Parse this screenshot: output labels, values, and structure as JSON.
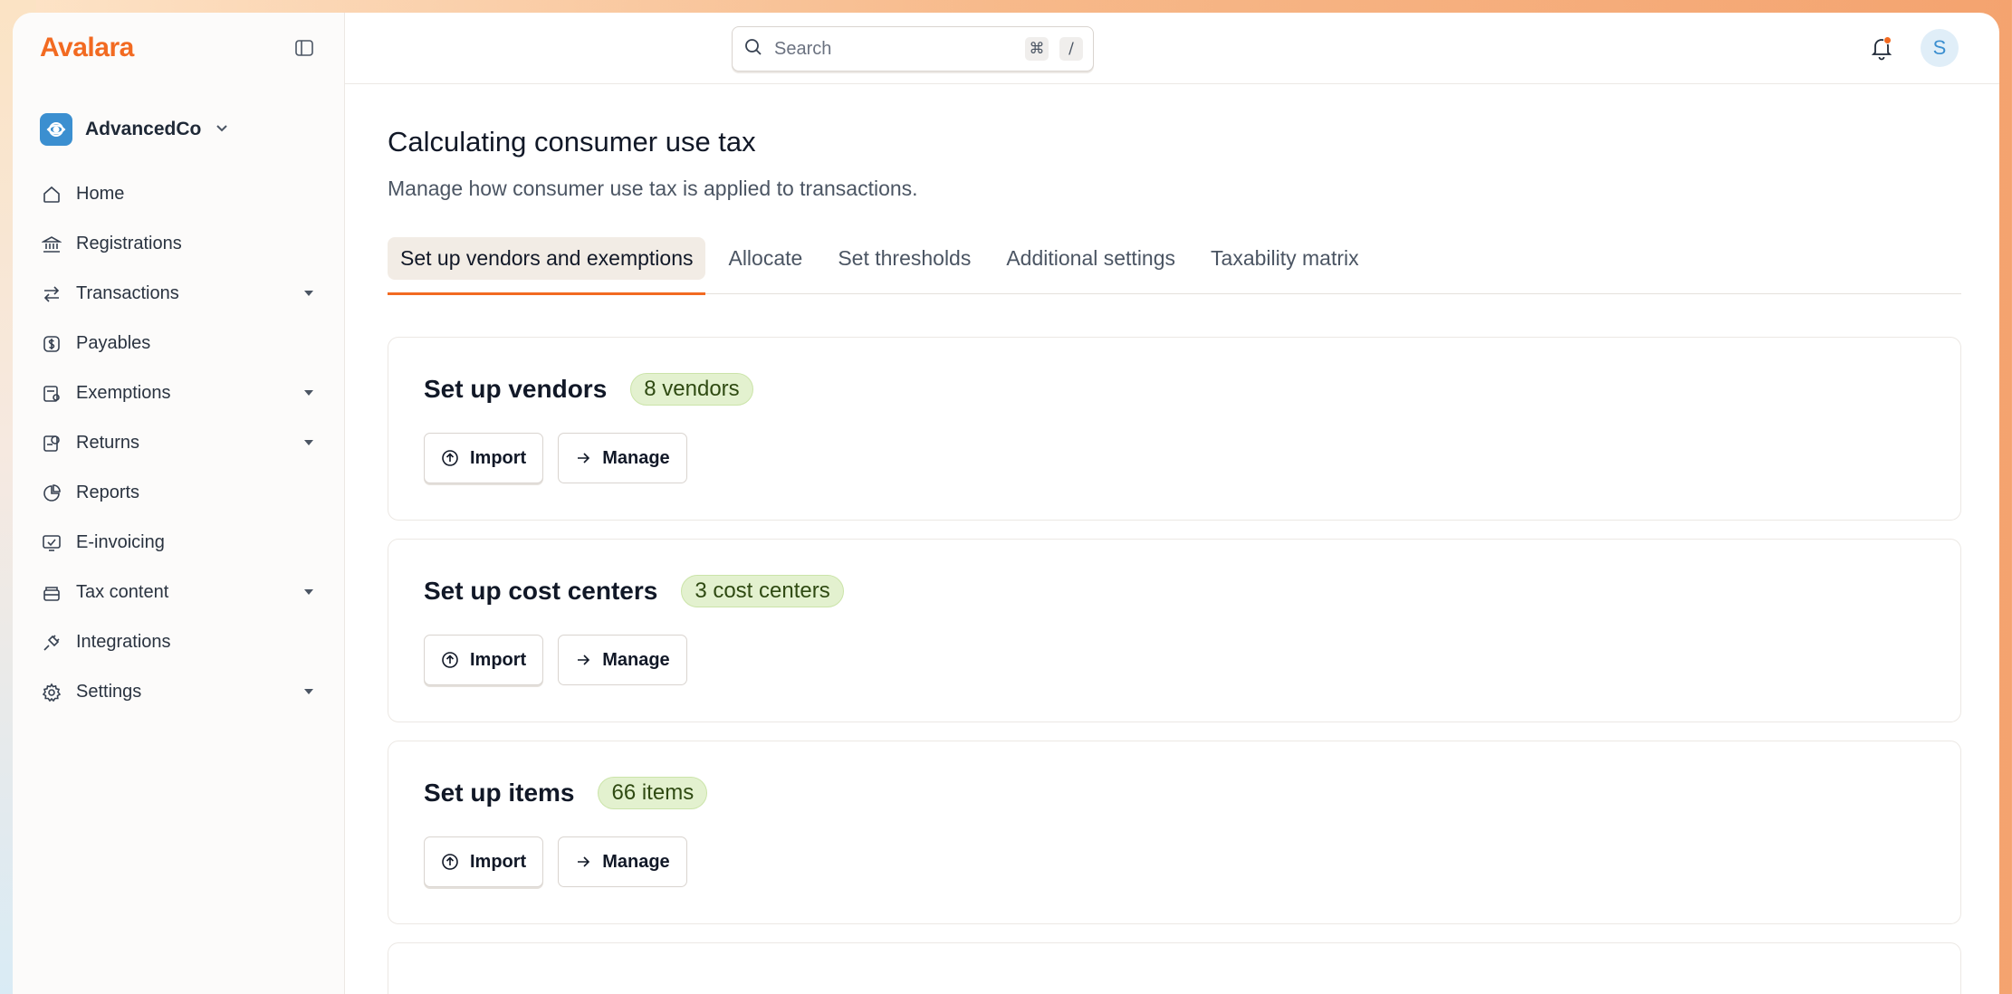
{
  "app": {
    "logo_text": "Avalara",
    "colors": {
      "brand": "#f26a21",
      "accent": "#3b8fd0",
      "badge_bg": "#e3f1cf"
    }
  },
  "sidebar": {
    "org": {
      "name": "AdvancedCo"
    },
    "items": [
      {
        "label": "Home",
        "icon": "home-icon",
        "has_caret": false
      },
      {
        "label": "Registrations",
        "icon": "bank-icon",
        "has_caret": false
      },
      {
        "label": "Transactions",
        "icon": "arrows-exchange-icon",
        "has_caret": true
      },
      {
        "label": "Payables",
        "icon": "dollar-badge-icon",
        "has_caret": false
      },
      {
        "label": "Exemptions",
        "icon": "certificate-icon",
        "has_caret": true
      },
      {
        "label": "Returns",
        "icon": "return-doc-icon",
        "has_caret": true
      },
      {
        "label": "Reports",
        "icon": "pie-chart-icon",
        "has_caret": false
      },
      {
        "label": "E-invoicing",
        "icon": "monitor-check-icon",
        "has_caret": false
      },
      {
        "label": "Tax content",
        "icon": "stack-icon",
        "has_caret": true
      },
      {
        "label": "Integrations",
        "icon": "plug-icon",
        "has_caret": false
      },
      {
        "label": "Settings",
        "icon": "gear-icon",
        "has_caret": true
      }
    ]
  },
  "header": {
    "search": {
      "placeholder": "Search",
      "shortcut_keys": [
        "⌘",
        "/"
      ]
    },
    "avatar_initial": "S"
  },
  "main": {
    "title": "Calculating consumer use tax",
    "subtitle": "Manage how consumer use tax is applied to transactions.",
    "tabs": [
      {
        "label": "Set up vendors and exemptions",
        "active": true
      },
      {
        "label": "Allocate",
        "active": false
      },
      {
        "label": "Set thresholds",
        "active": false
      },
      {
        "label": "Additional settings",
        "active": false
      },
      {
        "label": "Taxability matrix",
        "active": false
      }
    ],
    "cards": [
      {
        "title": "Set up vendors",
        "badge": "8 vendors",
        "import_label": "Import",
        "manage_label": "Manage"
      },
      {
        "title": "Set up cost centers",
        "badge": "3 cost centers",
        "import_label": "Import",
        "manage_label": "Manage"
      },
      {
        "title": "Set up items",
        "badge": "66 items",
        "import_label": "Import",
        "manage_label": "Manage"
      }
    ]
  }
}
